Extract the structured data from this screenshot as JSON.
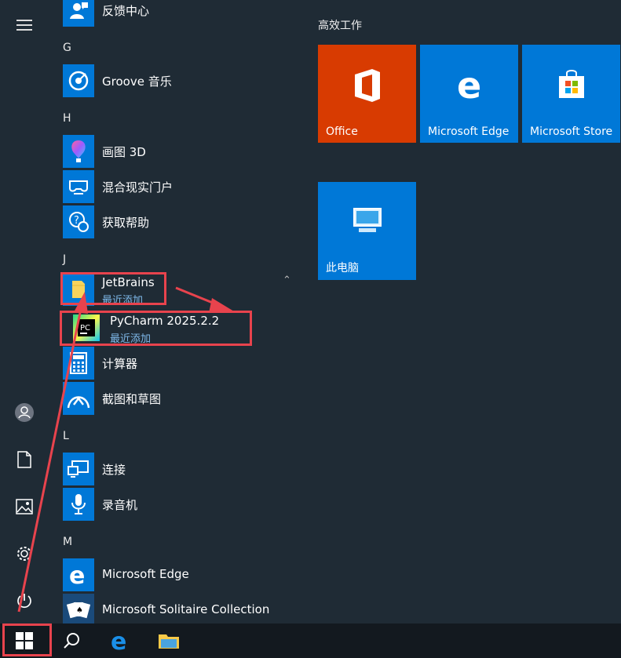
{
  "start_menu": {
    "app_list": [
      {
        "type": "app",
        "label": "反馈中心",
        "icon": "feedback-icon"
      },
      {
        "type": "letter",
        "label": "G"
      },
      {
        "type": "app",
        "label": "Groove 音乐",
        "icon": "music-icon"
      },
      {
        "type": "letter",
        "label": "H"
      },
      {
        "type": "app",
        "label": "画图 3D",
        "icon": "paint3d-icon"
      },
      {
        "type": "app",
        "label": "混合现实门户",
        "icon": "vr-headset-icon"
      },
      {
        "type": "app",
        "label": "获取帮助",
        "icon": "help-icon"
      },
      {
        "type": "letter",
        "label": "J"
      },
      {
        "type": "app",
        "label": "JetBrains",
        "sub": "最近添加",
        "icon": "folder-icon"
      },
      {
        "type": "app",
        "label": "PyCharm 2025.2.2",
        "sub": "最近添加",
        "icon": "pycharm-icon"
      },
      {
        "type": "app",
        "label": "计算器",
        "icon": "calculator-icon"
      },
      {
        "type": "app",
        "label": "截图和草图",
        "icon": "snip-icon"
      },
      {
        "type": "letter",
        "label": "L"
      },
      {
        "type": "app",
        "label": "连接",
        "icon": "connect-icon"
      },
      {
        "type": "app",
        "label": "录音机",
        "icon": "microphone-icon"
      },
      {
        "type": "letter",
        "label": "M"
      },
      {
        "type": "app",
        "label": "Microsoft Edge",
        "icon": "edge-icon"
      },
      {
        "type": "app",
        "label": "Microsoft Solitaire Collection",
        "icon": "cards-icon"
      }
    ],
    "tiles_group_title": "高效工作",
    "tiles": [
      {
        "label": "Office",
        "icon": "office-icon",
        "color": "#d83b01"
      },
      {
        "label": "Microsoft Edge",
        "icon": "edge-icon",
        "color": "#0078d7"
      },
      {
        "label": "Microsoft Store",
        "icon": "store-icon",
        "color": "#0078d7"
      },
      {
        "label": "此电脑",
        "icon": "computer-icon",
        "color": "#0078d7"
      }
    ]
  },
  "left_rail": [
    "hamburger-menu-icon",
    "user-avatar-icon",
    "documents-icon",
    "pictures-icon",
    "settings-icon",
    "power-icon"
  ],
  "taskbar": [
    "windows-start-icon",
    "search-icon",
    "edge-icon",
    "file-explorer-icon"
  ],
  "colors": {
    "accent": "#0078d7",
    "annotation": "#e8434d",
    "background": "#1f2b35"
  }
}
